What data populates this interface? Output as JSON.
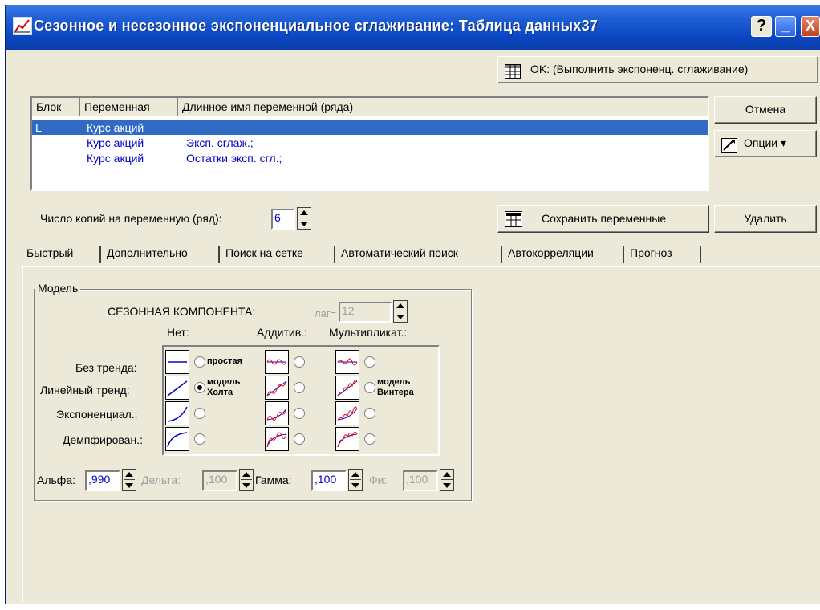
{
  "window": {
    "title": "Сезонное и несезонное экспоненциальное сглаживание: Таблица данных37",
    "help": "?",
    "minimize": "_",
    "close": "X"
  },
  "buttons": {
    "ok": "OK: (Выполнить экспоненц. сглаживание)",
    "cancel": "Отмена",
    "options": "Опции ▾",
    "save_vars": "Сохранить переменные",
    "delete": "Удалить"
  },
  "list": {
    "columns": [
      "Блок",
      "Переменная",
      "Длинное имя переменной (ряда)"
    ],
    "rows": [
      {
        "block": "L",
        "variable": "Курс акций",
        "longname": ""
      },
      {
        "block": "",
        "variable": "Курс акций",
        "longname": "Эксп. сглаж.;"
      },
      {
        "block": "",
        "variable": "Курс акций",
        "longname": "Остатки эксп. сгл.;"
      }
    ]
  },
  "copies": {
    "label": "Число копий на переменную (ряд):",
    "value": "6"
  },
  "tabs": [
    "Быстрый",
    "Дополнительно",
    "Поиск на сетке",
    "Автоматический поиск",
    "Автокорреляции",
    "Прогноз"
  ],
  "model": {
    "group_title": "Модель",
    "seasonal_label": "СЕЗОННАЯ КОМПОНЕНТА:",
    "lag_label": "лаг=",
    "lag_value": "12",
    "col_none": "Нет:",
    "col_add": "Аддитив.:",
    "col_mult": "Мультипликат.:",
    "rows": [
      "Без тренда:",
      "Линейный тренд:",
      "Экспоненциал.:",
      "Демпфирован.:"
    ],
    "simple": "простая",
    "holt_1": "модель",
    "holt_2": "Холта",
    "winters_1": "модель",
    "winters_2": "Винтера",
    "selected": "linear-none"
  },
  "params": {
    "alpha_label": "Альфа:",
    "alpha": ",990",
    "delta_label": "Дельта:",
    "delta": ",100",
    "gamma_label": "Гамма:",
    "gamma": ",100",
    "phi_label": "Фи:",
    "phi": ",100"
  },
  "colors": {
    "titlebar": "#0b47c3",
    "selection": "#316ac5",
    "face": "#ece9d8",
    "curve_red": "#ff0000",
    "curve_blue": "#0000cc"
  }
}
